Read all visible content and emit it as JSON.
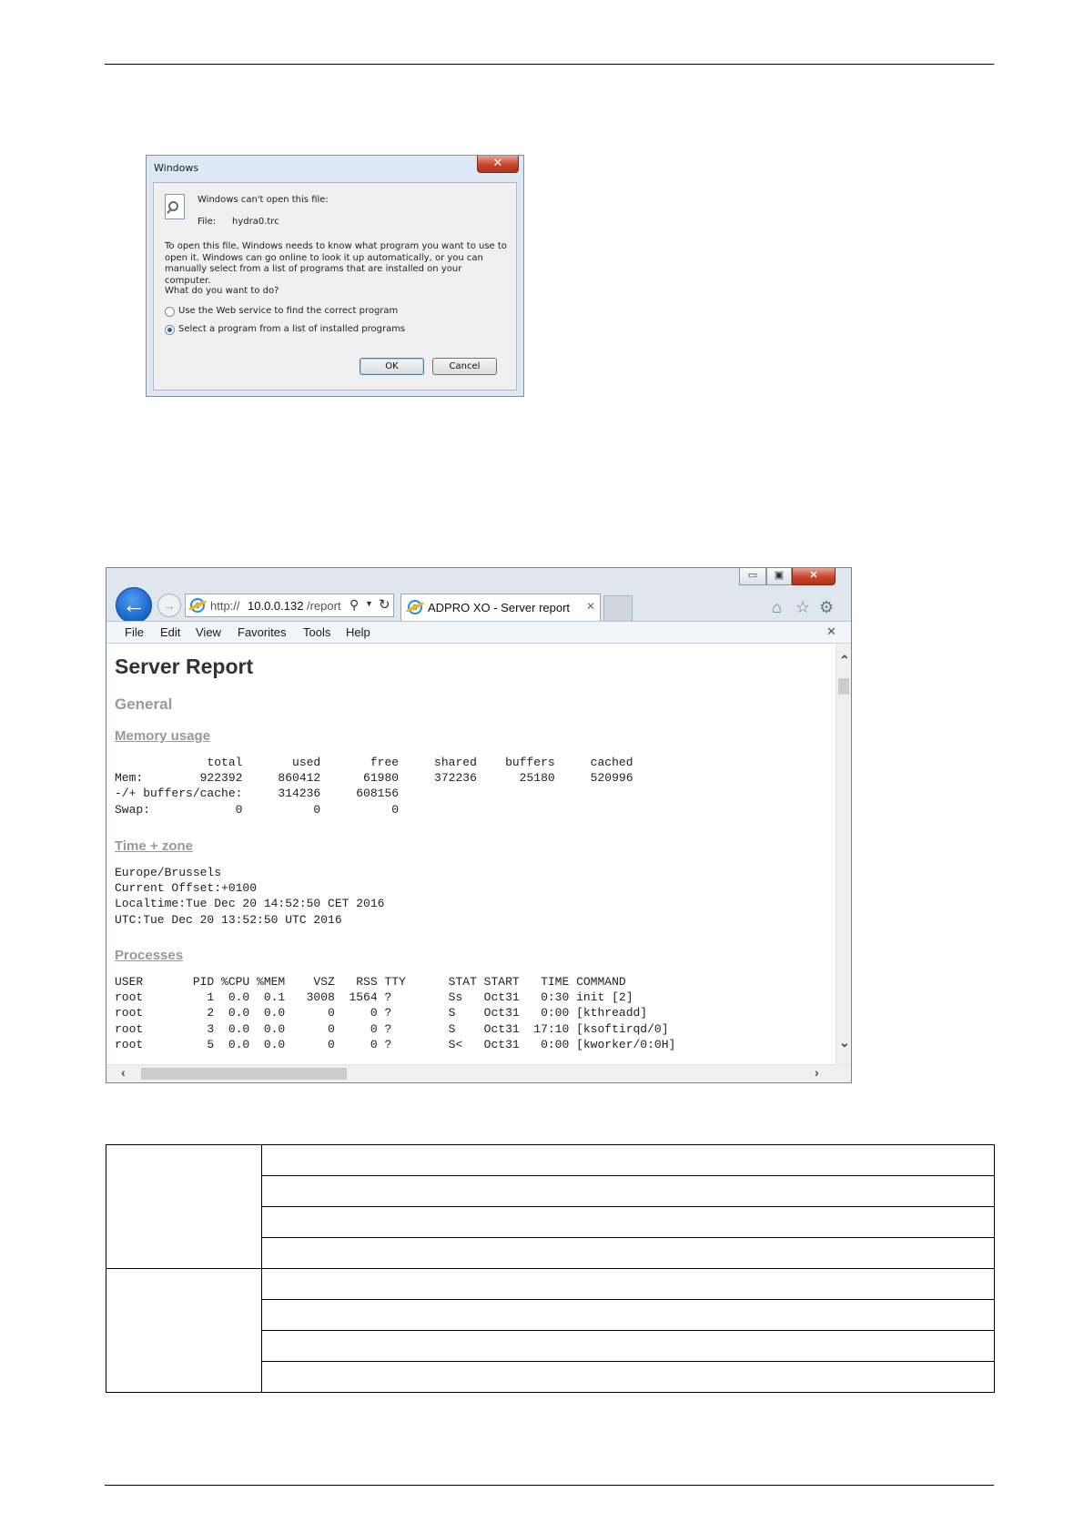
{
  "dialog": {
    "title": "Windows",
    "close_glyph": "✕",
    "heading": "Windows can't open this file:",
    "file_label": "File:",
    "file_name": "hydra0.trc",
    "explanation": "To open this file, Windows needs to know what program you want to use to open it. Windows can go online to look it up automatically, or you can manually select from a list of programs that are installed on your computer.",
    "question": "What do you want to do?",
    "options": [
      {
        "label": "Use the Web service to find the correct program",
        "selected": false
      },
      {
        "label": "Select a program from a list of installed programs",
        "selected": true
      }
    ],
    "ok_label": "OK",
    "cancel_label": "Cancel",
    "icon": "document-search-icon"
  },
  "browser": {
    "url_prefix": "http://",
    "url_host": "10.0.0.132",
    "url_path": "/report",
    "tab_title": "ADPRO XO - Server report",
    "tab_close": "✕",
    "window_buttons": {
      "minimize": "▭",
      "maximize": "▣",
      "close": "✕"
    },
    "nav_icons": {
      "back": "back-arrow-icon",
      "forward": "forward-arrow-icon",
      "home": "home-icon",
      "favorites": "star-icon",
      "settings": "gear-icon"
    },
    "menu": [
      "File",
      "Edit",
      "View",
      "Favorites",
      "Tools",
      "Help"
    ],
    "menu_close": "✕",
    "accent": "#1463c9"
  },
  "report": {
    "title": "Server Report",
    "general": "General",
    "memory_heading": "Memory usage",
    "memory_lines": [
      "             total       used       free     shared    buffers     cached",
      "Mem:        922392     860412      61980     372236      25180     520996",
      "-/+ buffers/cache:     314236     608156",
      "Swap:            0          0          0"
    ],
    "time_heading": "Time + zone",
    "time_lines": [
      "Europe/Brussels",
      "Current Offset:+0100",
      "Localtime:Tue Dec 20 14:52:50 CET 2016",
      "UTC:Tue Dec 20 13:52:50 UTC 2016"
    ],
    "processes_heading": "Processes",
    "process_lines": [
      "USER       PID %CPU %MEM    VSZ   RSS TTY      STAT START   TIME COMMAND",
      "root         1  0.0  0.1   3008  1564 ?        Ss   Oct31   0:30 init [2]",
      "root         2  0.0  0.0      0     0 ?        S    Oct31   0:00 [kthreadd]",
      "root         3  0.0  0.0      0     0 ?        S    Oct31  17:10 [ksoftirqd/0]",
      "root         5  0.0  0.0      0     0 ?        S<   Oct31   0:00 [kworker/0:0H]"
    ]
  }
}
